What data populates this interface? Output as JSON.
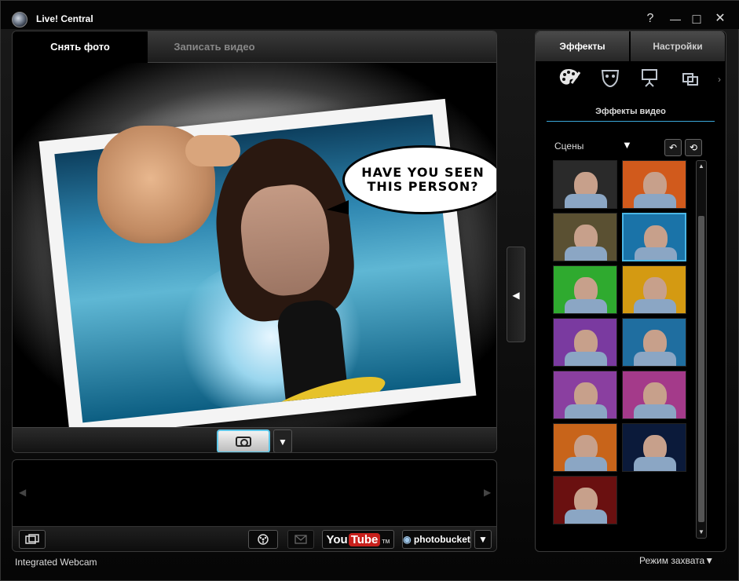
{
  "window": {
    "title": "Live! Central",
    "controls": {
      "help": "?",
      "minimize": "—",
      "maximize": "□",
      "close": "✕"
    }
  },
  "left_tabs": [
    {
      "label": "Снять фото",
      "active": true
    },
    {
      "label": "Записать видео",
      "active": false
    }
  ],
  "preview": {
    "bubble_line1": "HAVE YOU SEEN",
    "bubble_line2": "THIS PERSON?"
  },
  "capture": {
    "camera_icon": "camera-icon",
    "dropdown_glyph": "▼"
  },
  "strip": {
    "left_arrow": "◀",
    "right_arrow": "▶"
  },
  "toolbar": {
    "youtube_you": "You",
    "youtube_tube": "Tube",
    "youtube_tm": "TM",
    "photobucket": "photobucket",
    "dropdown_glyph": "▼"
  },
  "collapse_glyph": "◀",
  "right_tabs": [
    {
      "label": "Эффекты",
      "active": true
    },
    {
      "label": "Настройки",
      "active": false
    }
  ],
  "effect_icons": [
    "palette-icon",
    "mask-icon",
    "presentation-icon",
    "frames-icon"
  ],
  "effects_more": "›",
  "section_title": "Эффекты видео",
  "scenes": {
    "label": "Сцены",
    "dropdown_glyph": "▼",
    "undo_glyph": "↶",
    "reset_glyph": "⟲"
  },
  "thumbnails": [
    {
      "name": "scene-dark-swirl",
      "bg": "#2a2a2a",
      "selected": false
    },
    {
      "name": "scene-orange-frame",
      "bg": "#d15a1c",
      "selected": false
    },
    {
      "name": "scene-forest-frame",
      "bg": "#5a5032",
      "selected": false
    },
    {
      "name": "scene-have-you-seen",
      "bg": "#1a73a8",
      "selected": true
    },
    {
      "name": "scene-green-bars",
      "bg": "#2faa2f",
      "selected": false
    },
    {
      "name": "scene-city-gold",
      "bg": "#d49a12",
      "selected": false
    },
    {
      "name": "scene-purple-moon",
      "bg": "#7a3aa0",
      "selected": false
    },
    {
      "name": "scene-blue-city",
      "bg": "#1f6ea0",
      "selected": false
    },
    {
      "name": "scene-paris-purple",
      "bg": "#8a3fa0",
      "selected": false
    },
    {
      "name": "scene-pink-night",
      "bg": "#a43a8a",
      "selected": false
    },
    {
      "name": "scene-sunset-city",
      "bg": "#c8641a",
      "selected": false
    },
    {
      "name": "scene-space-bubble",
      "bg": "#0b1a3a",
      "selected": false
    },
    {
      "name": "scene-red-tv",
      "bg": "#6a1010",
      "selected": false
    }
  ],
  "status": {
    "device": "Integrated Webcam",
    "mode": "Режим захвата",
    "mode_glyph": "▼"
  }
}
